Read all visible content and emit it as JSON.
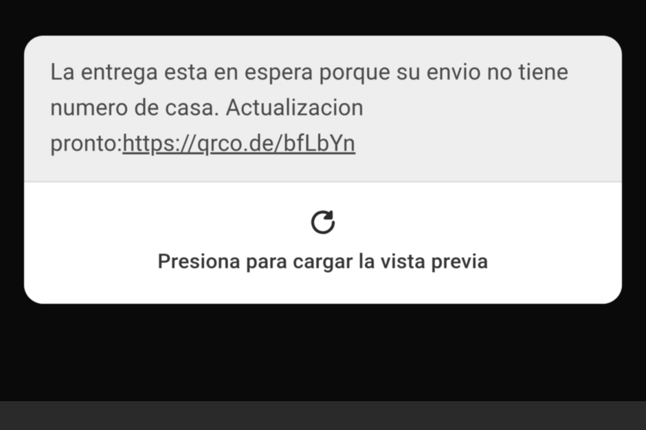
{
  "message": {
    "body_prefix": "La entrega esta en espera porque su envio no tiene numero de casa. Actualizacion pronto:",
    "link_text": "https://qrco.de/bfLbYn"
  },
  "preview": {
    "tap_label": "Presiona para cargar la vista previa"
  }
}
